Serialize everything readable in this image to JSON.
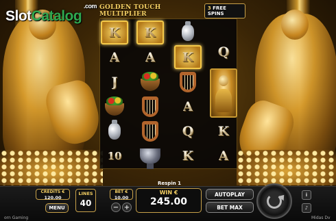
{
  "watermark": {
    "part1": "Slot",
    "part2": "Catalog",
    "suffix": ".com"
  },
  "header": {
    "title": "GOLDEN TOUCH MULTIPLIER",
    "free_spins_count": "3",
    "free_spins_label": "FREE SPINS"
  },
  "reels": [
    [
      "K",
      "A",
      "J",
      "bowl-of-fruit",
      "vase",
      "10"
    ],
    [
      "K",
      "A",
      "bowl-of-fruit",
      "lyre",
      "lyre",
      "chalice"
    ],
    [
      "vase",
      "K",
      "lyre",
      "A",
      "Q",
      "K"
    ],
    [
      "Q",
      "midas-wild",
      "K",
      "A"
    ]
  ],
  "highlighted_symbols": [
    "reel1-K",
    "reel2-K",
    "reel3-K"
  ],
  "status": {
    "respin": "Respin 1"
  },
  "credits": {
    "label": "CREDITS €",
    "value": "120.00"
  },
  "lines": {
    "label": "LINES",
    "value": "40"
  },
  "bet": {
    "label": "BET €",
    "value": "10.00"
  },
  "win": {
    "label": "WIN €",
    "value": "245.00"
  },
  "buttons": {
    "menu": "MENU",
    "autoplay": "AUTOPLAY",
    "bet_max": "BET MAX",
    "minus": "−",
    "plus": "+"
  },
  "footer": {
    "left": "orn Gaming",
    "right": "Midas Dv"
  },
  "colors": {
    "accent_gold": "#f4cf63",
    "brand_green": "#2fa84f",
    "panel_border": "#c9a24a"
  }
}
